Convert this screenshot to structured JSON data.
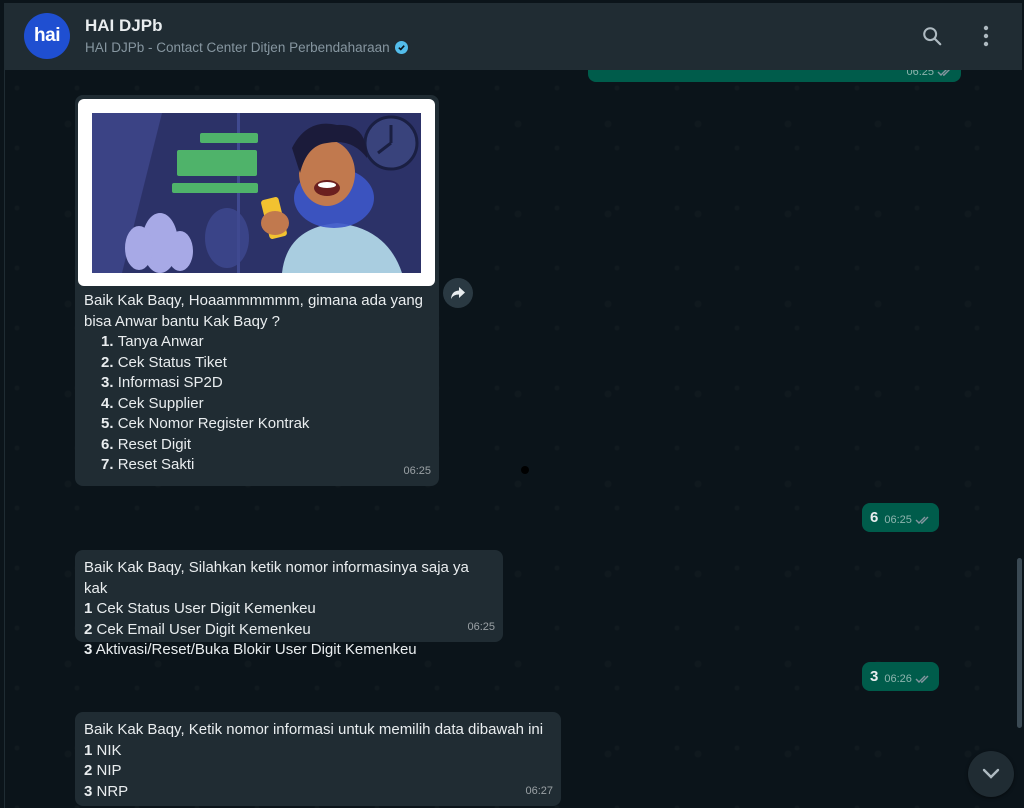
{
  "header": {
    "contact_name": "HAI DJPb",
    "contact_subtitle": "HAI DJPb - Contact Center Ditjen Perbendaharaan",
    "avatar_text": "hai"
  },
  "messages": {
    "top_partial": {
      "time": "06:25"
    },
    "greeting": {
      "intro_line1": "Baik Kak Baqy, Hoaammmmmm, gimana ada yang",
      "intro_line2": "bisa Anwar bantu Kak Baqy ?",
      "items": [
        {
          "num": "1.",
          "text": "Tanya Anwar"
        },
        {
          "num": "2.",
          "text": "Cek Status Tiket"
        },
        {
          "num": "3.",
          "text": "Informasi SP2D"
        },
        {
          "num": "4.",
          "text": "Cek Supplier"
        },
        {
          "num": "5.",
          "text": "Cek Nomor Register Kontrak"
        },
        {
          "num": "6.",
          "text": "Reset Digit"
        },
        {
          "num": "7.",
          "text": "Reset Sakti"
        }
      ],
      "time": "06:25",
      "image_bubbles": [
        "",
        "",
        ""
      ]
    },
    "reply1": {
      "text": "6",
      "time": "06:25"
    },
    "digit_menu": {
      "intro": "Baik Kak Baqy, Silahkan ketik nomor informasinya saja ya kak",
      "items": [
        {
          "num": "1",
          "text": "Cek Status User Digit Kemenkeu"
        },
        {
          "num": "2",
          "text": "Cek Email User Digit Kemenkeu"
        },
        {
          "num": "3",
          "text": "Aktivasi/Reset/Buka Blokir User Digit Kemenkeu"
        }
      ],
      "time": "06:25"
    },
    "reply2": {
      "text": "3",
      "time": "06:26"
    },
    "data_menu": {
      "intro": "Baik Kak Baqy, Ketik nomor informasi untuk memilih data dibawah ini",
      "items": [
        {
          "num": "1",
          "text": "NIK"
        },
        {
          "num": "2",
          "text": "NIP"
        },
        {
          "num": "3",
          "text": "NRP"
        }
      ],
      "time": "06:27"
    }
  },
  "colors": {
    "header_bg": "#202c33",
    "chat_bg": "#0b141a",
    "incoming_bubble": "#202c33",
    "outgoing_bubble": "#005c4b",
    "avatar_bg": "#1f4fd1",
    "verified": "#53bdeb"
  },
  "icons": {
    "search": "search-icon",
    "menu": "kebab-menu-icon",
    "forward": "forward-icon",
    "scroll": "chevron-down-icon",
    "read_receipt": "double-check-icon"
  }
}
